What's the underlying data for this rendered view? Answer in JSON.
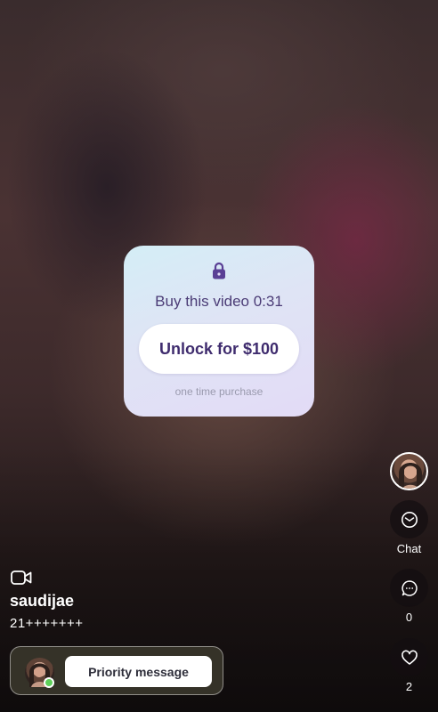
{
  "unlock_card": {
    "title": "Buy this video 0:31",
    "button_label": "Unlock for $100",
    "note": "one time purchase",
    "icon": "lock-icon"
  },
  "right_rail": {
    "chat_label": "Chat",
    "comments_count": "0",
    "likes_count": "2",
    "icons": [
      "creator-avatar",
      "mail-icon",
      "comment-icon",
      "heart-icon"
    ]
  },
  "post": {
    "username": "saudijae",
    "caption": "21+++++++",
    "media_icon": "video-camera-icon"
  },
  "priority_message": {
    "label": "Priority message",
    "status": "online"
  },
  "colors": {
    "accent": "#3f2c6e",
    "card_gradient_start": "#d4eef6",
    "card_gradient_end": "#e3dbf6",
    "online": "#5fd05a"
  }
}
